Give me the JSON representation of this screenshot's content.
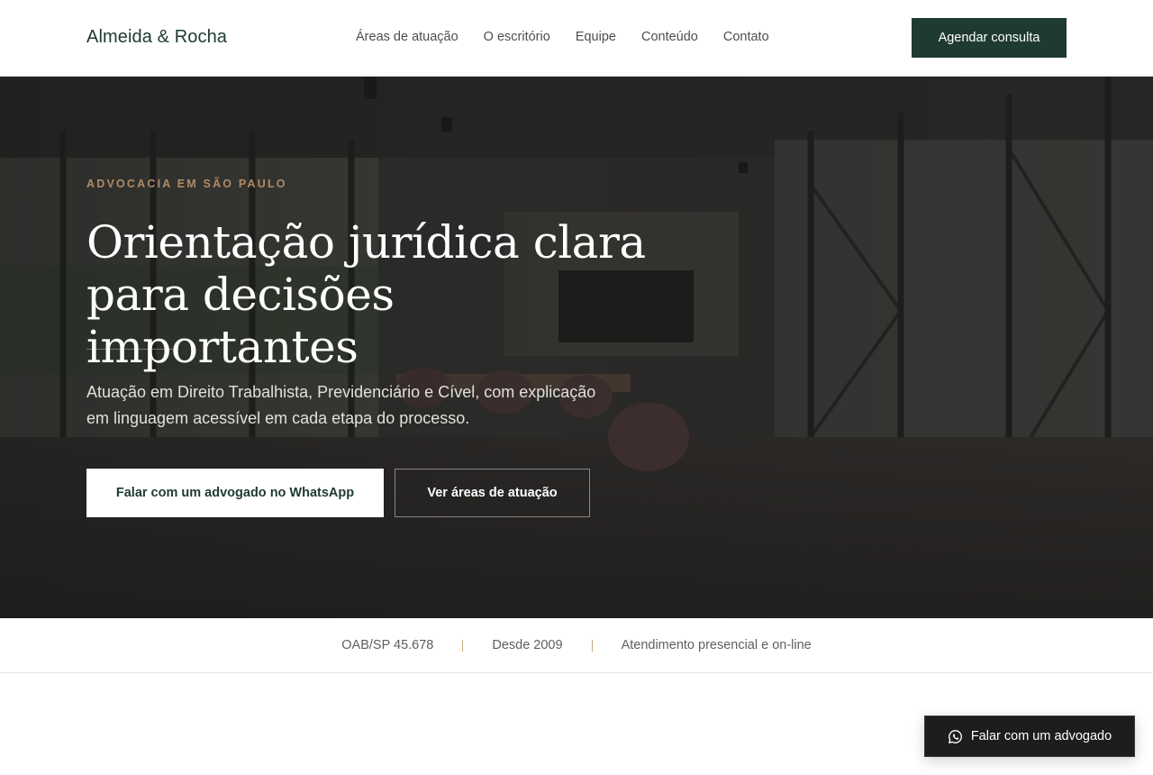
{
  "header": {
    "brand": "Almeida & Rocha",
    "nav": [
      "Áreas de atuação",
      "O escritório",
      "Equipe",
      "Conteúdo",
      "Contato"
    ],
    "cta_label": "Agendar consulta"
  },
  "hero": {
    "eyebrow": "ADVOCACIA EM SÃO PAULO",
    "title_line1": "Orientação jurídica clara",
    "title_line2": "para decisões importantes",
    "subtitle": "Atuação em Direito Trabalhista, Previdenciário e Cível, com explicação em linguagem acessível em cada etapa do processo.",
    "primary_button": "Falar com um advogado no WhatsApp",
    "secondary_button": "Ver áreas de atuação"
  },
  "infobar": {
    "items": [
      "OAB/SP 45.678",
      "Desde 2009",
      "Atendimento presencial e on-line"
    ]
  },
  "floating": {
    "label": "Falar com um advogado",
    "icon": "whatsapp-icon"
  },
  "colors": {
    "brand_green": "#1f3a33",
    "accent_gold": "#b08a66",
    "hero_overlay": "#1c1c1b"
  }
}
